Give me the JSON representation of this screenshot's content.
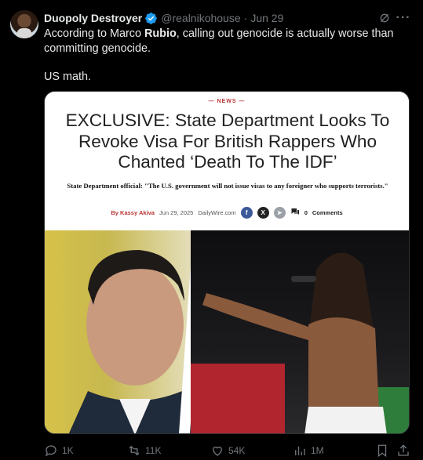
{
  "author": {
    "name": "Duopoly Destroyer",
    "handle": "@realnikohouse",
    "separator": "·",
    "date": "Jun 29"
  },
  "post": {
    "line1_before": "According to Marco ",
    "line1_bold": "Rubio",
    "line1_after": ", calling out genocide is actually worse than committing genocide.",
    "line2": "US math."
  },
  "article": {
    "section": "— NEWS —",
    "headline": "EXCLUSIVE: State Department Looks To Revoke Visa For British Rappers Who Chanted ‘Death To The IDF’",
    "subhead": "State Department official: \"The U.S. government will not issue visas to any foreigner who supports terrorists.\"",
    "by_label": "By Kassy Akiva",
    "date": "Jun 29, 2025",
    "site": "DailyWire.com",
    "comment_count": "0",
    "comments_label": "Comments"
  },
  "actions": {
    "replies": "1K",
    "reposts": "11K",
    "likes": "54K",
    "views": "1M"
  },
  "colors": {
    "accent": "#1d9bf0",
    "muted": "#71767b",
    "text": "#e7e9ea",
    "background": "#000000"
  }
}
